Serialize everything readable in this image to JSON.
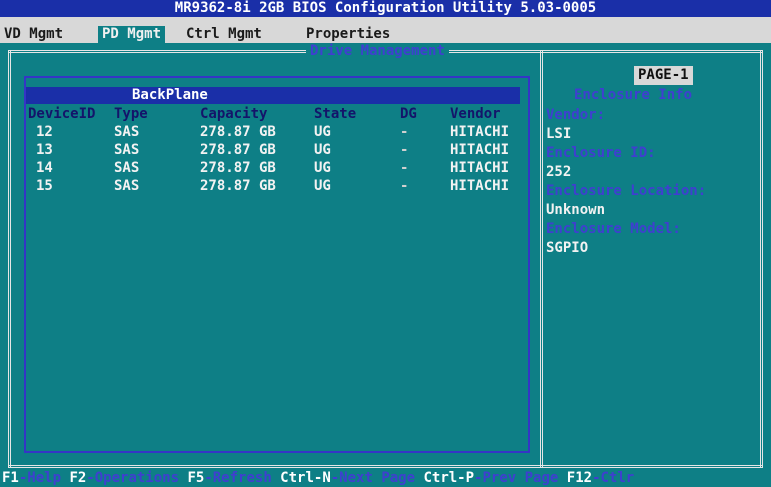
{
  "title": "MR9362-8i 2GB BIOS Configuration Utility 5.03-0005",
  "menu": [
    {
      "label": "VD Mgmt",
      "active": false
    },
    {
      "label": "PD Mgmt",
      "active": true
    },
    {
      "label": "Ctrl Mgmt",
      "active": false
    },
    {
      "label": "Properties",
      "active": false
    }
  ],
  "panel_caption": "Drive Management",
  "backplane": {
    "label": "BackPlane",
    "columns": [
      "DeviceID",
      "Type",
      "Capacity",
      "State",
      "DG",
      "Vendor"
    ],
    "rows": [
      {
        "device_id": "12",
        "type": "SAS",
        "capacity": "278.87 GB",
        "state": "UG",
        "dg": "-",
        "vendor": "HITACHI"
      },
      {
        "device_id": "13",
        "type": "SAS",
        "capacity": "278.87 GB",
        "state": "UG",
        "dg": "-",
        "vendor": "HITACHI"
      },
      {
        "device_id": "14",
        "type": "SAS",
        "capacity": "278.87 GB",
        "state": "UG",
        "dg": "-",
        "vendor": "HITACHI"
      },
      {
        "device_id": "15",
        "type": "SAS",
        "capacity": "278.87 GB",
        "state": "UG",
        "dg": "-",
        "vendor": "HITACHI"
      }
    ]
  },
  "info_panel": {
    "page": "PAGE-1",
    "heading": "Enclosure Info",
    "vendor_label": "Vendor:",
    "vendor_value": "LSI",
    "enclosure_id_label": "Enclosure ID:",
    "enclosure_id_value": "252",
    "location_label": "Enclosure Location:",
    "location_value": "Unknown",
    "model_label": "Enclosure Model:",
    "model_value": "SGPIO"
  },
  "status_bar": [
    {
      "key": "F1",
      "desc": "-Help "
    },
    {
      "key": "F2",
      "desc": "-Operations "
    },
    {
      "key": "F5",
      "desc": "-Refresh "
    },
    {
      "key": "Ctrl-N",
      "desc": "-Next Page "
    },
    {
      "key": "Ctrl-P",
      "desc": "-Prev Page "
    },
    {
      "key": "F12",
      "desc": "-Ctlr"
    }
  ],
  "colors": {
    "background": "#0e7f86",
    "title_bar": "#1a2fa8",
    "menu_bar": "#d8d8d8",
    "label_blue": "#3f3fd0",
    "header_text": "#14146a"
  }
}
